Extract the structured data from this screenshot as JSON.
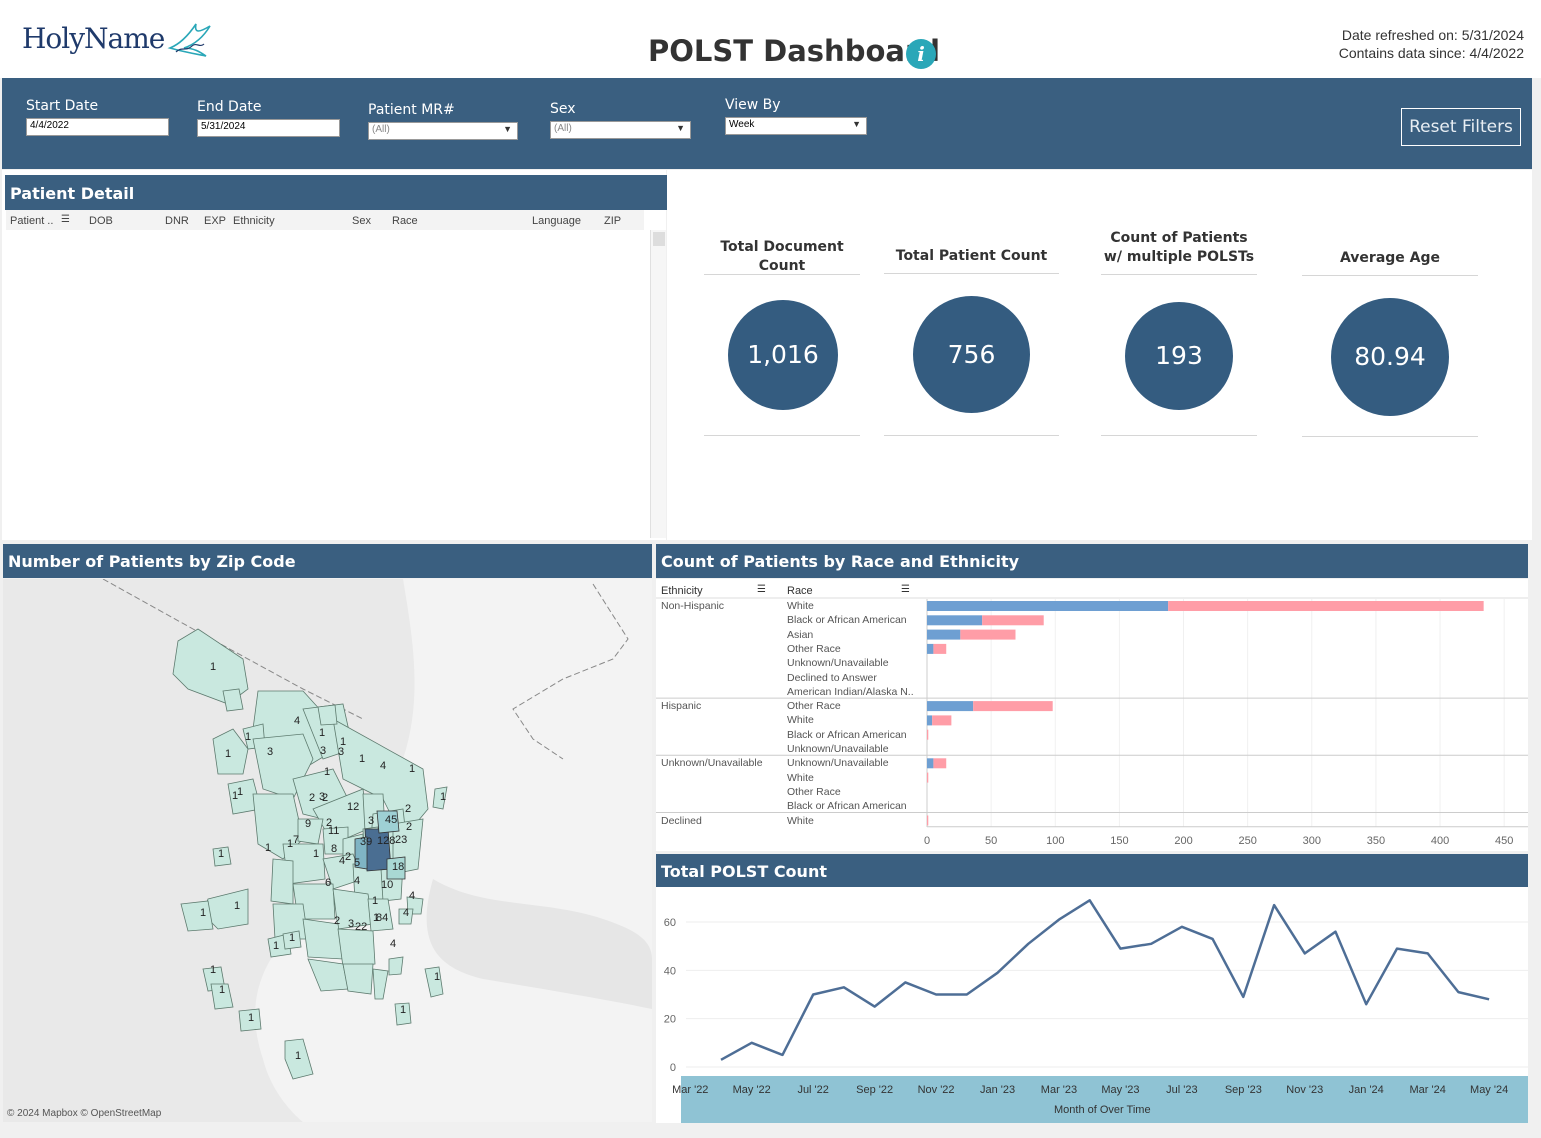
{
  "header": {
    "logo_text": "HolyName",
    "title": "POLST Dashboard",
    "info_icon": "info-icon",
    "refreshed": "Date refreshed on: 5/31/2024",
    "since": "Contains data since: 4/4/2022"
  },
  "filters": {
    "start_label": "Start Date",
    "start_value": "4/4/2022",
    "end_label": "End Date",
    "end_value": "5/31/2024",
    "mr_label": "Patient MR#",
    "mr_value": "(All)",
    "sex_label": "Sex",
    "sex_value": "(All)",
    "viewby_label": "View By",
    "viewby_value": "Week",
    "reset_label": "Reset Filters"
  },
  "patient_detail": {
    "title": "Patient Detail",
    "columns": [
      "Patient ..",
      "DOB",
      "DNR",
      "EXP",
      "Ethnicity",
      "Sex",
      "Race",
      "Language",
      "ZIP"
    ]
  },
  "kpis": [
    {
      "label": "Total Document Count",
      "value": "1,016"
    },
    {
      "label": "Total Patient Count",
      "value": "756"
    },
    {
      "label": "Count of Patients w/ multiple POLSTs",
      "label_line1": "Count of Patients",
      "label_line2": "w/ multiple POLSTs",
      "value": "193"
    },
    {
      "label": "Average Age",
      "value": "80.94"
    }
  ],
  "map_panel": {
    "title": "Number of Patients by  Zip Code",
    "attribution": "© 2024 Mapbox  © OpenStreetMap",
    "labels": [
      "1",
      "4",
      "1",
      "1",
      "3",
      "3",
      "1",
      "1",
      "1",
      "3",
      "4",
      "1",
      "1",
      "3",
      "12",
      "3",
      "45",
      "128",
      "39",
      "23",
      "2",
      "2",
      "2",
      "9",
      "11",
      "7",
      "8",
      "4",
      "5",
      "6",
      "4",
      "10",
      "18",
      "84",
      "1",
      "22",
      "3",
      "2",
      "1",
      "2",
      "2",
      "2",
      "1",
      "1",
      "1",
      "1",
      "1",
      "1",
      "1",
      "1",
      "1",
      "1",
      "1",
      "1",
      "1",
      "1",
      "4",
      "4",
      "4",
      "1",
      "1",
      "1"
    ]
  },
  "race_panel": {
    "title": "Count of Patients by Race and Ethnicity",
    "col_ethnicity": "Ethnicity",
    "col_race": "Race",
    "sort_icon": "sort-icon"
  },
  "polst_panel": {
    "title": "Total POLST Count",
    "xlabel": "Month of Over Time"
  },
  "colors": {
    "navy": "#3a5f80",
    "kpi_circle": "#345c80",
    "female_bar": "#ff9da7",
    "male_bar": "#6e9fd2",
    "line": "#4e6e96",
    "map_fill": "#c9e8df",
    "map_high": "#4a6e92",
    "axis_band": "#8fc3d4"
  },
  "chart_data": [
    {
      "type": "bar",
      "orientation": "horizontal",
      "stacked": true,
      "groups": [
        {
          "ethnicity": "Non-Hispanic",
          "races": [
            "White",
            "Black or African American",
            "Asian",
            "Other Race",
            "Unknown/Unavailable",
            "Declined to Answer",
            "American Indian/Alaska N.."
          ]
        },
        {
          "ethnicity": "Hispanic",
          "races": [
            "Other Race",
            "White",
            "Black or African American",
            "Unknown/Unavailable"
          ]
        },
        {
          "ethnicity": "Unknown/Unavailable",
          "races": [
            "Unknown/Unavailable",
            "White",
            "Other Race",
            "Black or African American"
          ]
        },
        {
          "ethnicity": "Declined",
          "races": [
            "White"
          ]
        }
      ],
      "series": [
        {
          "values": [
            188,
            43,
            26,
            5,
            0,
            0,
            0,
            36,
            4,
            0,
            0,
            5,
            0,
            0,
            0,
            0
          ]
        },
        {
          "values": [
            246,
            48,
            43,
            10,
            0,
            0,
            0,
            62,
            15,
            1,
            0,
            10,
            1,
            0,
            0,
            1
          ]
        }
      ],
      "x_ticks": [
        0,
        50,
        100,
        150,
        200,
        250,
        300,
        350,
        400,
        450
      ],
      "xlim": [
        0,
        460
      ]
    },
    {
      "type": "line",
      "title": "Total POLST Count",
      "xlabel": "Month of Over Time",
      "x": [
        "Apr '22",
        "May '22",
        "Jun '22",
        "Jul '22",
        "Aug '22",
        "Sep '22",
        "Oct '22",
        "Nov '22",
        "Dec '22",
        "Jan '23",
        "Feb '23",
        "Mar '23",
        "Apr '23",
        "May '23",
        "Jun '23",
        "Jul '23",
        "Aug '23",
        "Sep '23",
        "Oct '23",
        "Nov '23",
        "Dec '23",
        "Jan '24",
        "Feb '24",
        "Mar '24",
        "Apr '24",
        "May '24"
      ],
      "x_ticks": [
        "Mar '22",
        "May '22",
        "Jul '22",
        "Sep '22",
        "Nov '22",
        "Jan '23",
        "Mar '23",
        "May '23",
        "Jul '23",
        "Sep '23",
        "Nov '23",
        "Jan '24",
        "Mar '24",
        "May '24"
      ],
      "values": [
        3,
        10,
        5,
        30,
        33,
        25,
        35,
        30,
        30,
        39,
        51,
        61,
        69,
        49,
        51,
        58,
        53,
        29,
        67,
        47,
        56,
        26,
        49,
        47,
        31,
        28
      ],
      "y_ticks": [
        0,
        20,
        40,
        60
      ],
      "ylim": [
        0,
        72
      ]
    }
  ]
}
